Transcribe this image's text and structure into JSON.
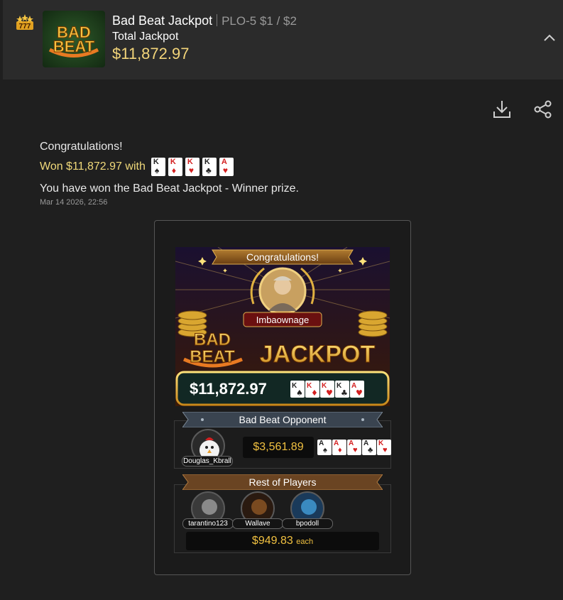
{
  "header": {
    "title": "Bad Beat Jackpot",
    "stakes": "PLO-5 $1 / $2",
    "subtitle": "Total Jackpot",
    "total_amount": "$11,872.97",
    "logo_line1": "BAD",
    "logo_line2": "BEAT"
  },
  "message": {
    "congrats": "Congratulations!",
    "won_text": "Won $11,872.97 with",
    "winning_cards": [
      {
        "rank": "K",
        "suit": "♠",
        "color": "#222222"
      },
      {
        "rank": "K",
        "suit": "♦",
        "color": "#d32020"
      },
      {
        "rank": "K",
        "suit": "♥",
        "color": "#d32020"
      },
      {
        "rank": "K",
        "suit": "♣",
        "color": "#222222"
      },
      {
        "rank": "A",
        "suit": "♥",
        "color": "#d32020"
      }
    ],
    "description": "You have won the Bad Beat Jackpot - Winner prize.",
    "timestamp": "Mar 14 2026, 22:56"
  },
  "banner": {
    "ribbon": "Congratulations!",
    "winner_name": "Imbaownage",
    "logo_bad": "BAD",
    "logo_beat": "BEAT",
    "jackpot_word": "JACKPOT",
    "prize": "$11,872.97",
    "cards": [
      {
        "rank": "K",
        "suit": "♠",
        "color": "#222222"
      },
      {
        "rank": "K",
        "suit": "♦",
        "color": "#d32020"
      },
      {
        "rank": "K",
        "suit": "♥",
        "color": "#d32020"
      },
      {
        "rank": "K",
        "suit": "♣",
        "color": "#222222"
      },
      {
        "rank": "A",
        "suit": "♥",
        "color": "#d32020"
      }
    ]
  },
  "opponent": {
    "section_title": "Bad Beat Opponent",
    "name": "Douglas_Kbrall",
    "prize": "$3,561.89",
    "cards": [
      {
        "rank": "A",
        "suit": "♠",
        "color": "#222222"
      },
      {
        "rank": "A",
        "suit": "♦",
        "color": "#d32020"
      },
      {
        "rank": "A",
        "suit": "♥",
        "color": "#d32020"
      },
      {
        "rank": "A",
        "suit": "♣",
        "color": "#222222"
      },
      {
        "rank": "K",
        "suit": "♥",
        "color": "#d32020"
      }
    ]
  },
  "rest": {
    "section_title": "Rest of Players",
    "players": [
      {
        "name": "tarantino123"
      },
      {
        "name": "Wallave"
      },
      {
        "name": "bpodoll"
      }
    ],
    "prize": "$949.83",
    "each_label": "each"
  },
  "colors": {
    "gold": "#f0c040",
    "won_text": "#f0d97a",
    "header_bg": "#2b2b2b",
    "panel_bg": "#1f1f1f"
  }
}
